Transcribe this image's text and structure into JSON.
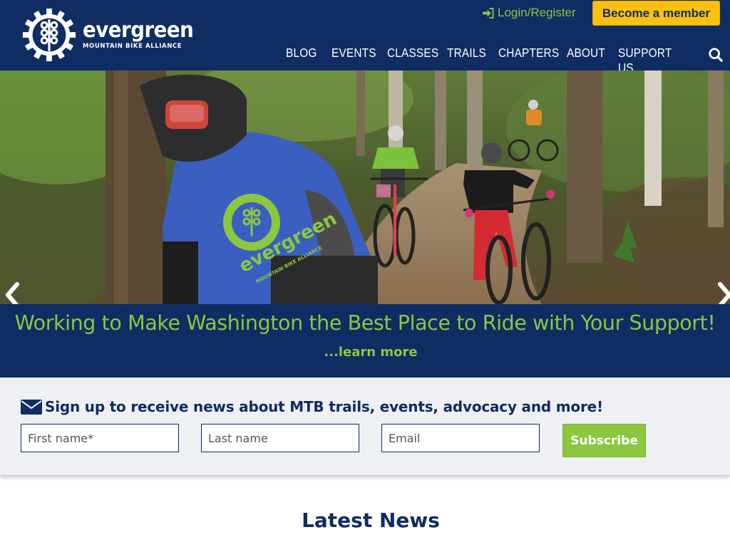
{
  "brand": {
    "name": "evergreen",
    "tagline": "MOUNTAIN BIKE ALLIANCE",
    "colors": {
      "navy": "#0f2d63",
      "green": "#8dc63f",
      "gold": "#fdc00e"
    }
  },
  "header": {
    "login_label": "Login/Register",
    "login_icon": "sign-in-icon",
    "member_button": "Become a member",
    "nav": [
      {
        "id": "blog",
        "label": "BLOG"
      },
      {
        "id": "events",
        "label": "EVENTS"
      },
      {
        "id": "classes",
        "label": "CLASSES"
      },
      {
        "id": "trails",
        "label": "TRAILS"
      },
      {
        "id": "chapters",
        "label": "CHAPTERS"
      },
      {
        "id": "about",
        "label": "ABOUT"
      },
      {
        "id": "support",
        "label": "SUPPORT US"
      }
    ],
    "search_icon": "search-icon"
  },
  "hero": {
    "image": "mountain-bikers-on-forest-trail",
    "jersey_text": "evergreen",
    "jersey_subtext": "MOUNTAIN BIKE ALLIANCE",
    "prev_icon": "chevron-left-icon",
    "next_icon": "chevron-right-icon"
  },
  "banner": {
    "title": "Working to Make Washington the Best Place to Ride with Your Support!",
    "link": "...learn more"
  },
  "signup": {
    "title": "Sign up to receive news about MTB trails, events, advocacy and more!",
    "icon": "envelope-icon",
    "first_name_placeholder": "First name*",
    "last_name_placeholder": "Last name",
    "email_placeholder": "Email",
    "button": "Subscribe"
  },
  "news": {
    "title": "Latest News"
  }
}
